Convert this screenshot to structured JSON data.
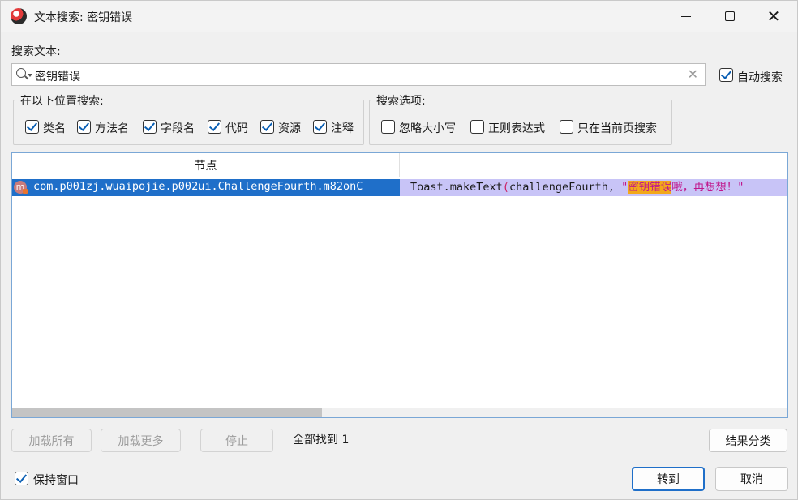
{
  "window": {
    "title": "文本搜索: 密钥错误",
    "minimize_glyph": "",
    "maximize_glyph": "",
    "close_glyph": "✕"
  },
  "search": {
    "label": "搜索文本:",
    "value": "密钥错误",
    "clear_glyph": "✕",
    "auto_search_label": "自动搜索",
    "auto_search_checked": true
  },
  "search_in": {
    "title": "在以下位置搜索:",
    "items": [
      {
        "label": "类名",
        "checked": true
      },
      {
        "label": "方法名",
        "checked": true
      },
      {
        "label": "字段名",
        "checked": true
      },
      {
        "label": "代码",
        "checked": true
      },
      {
        "label": "资源",
        "checked": true
      },
      {
        "label": "注释",
        "checked": true
      }
    ]
  },
  "options": {
    "title": "搜索选项:",
    "items": [
      {
        "label": "忽略大小写",
        "checked": false
      },
      {
        "label": "正则表达式",
        "checked": false
      },
      {
        "label": "只在当前页搜索",
        "checked": false
      }
    ]
  },
  "results": {
    "column_header": "节点",
    "rows": [
      {
        "node_icon": "m",
        "node": "com.p001zj.wuaipojie.p002ui.ChallengeFourth.m82onC",
        "code_prefix": "Toast.makeText",
        "code_paren": "(",
        "code_mid": "challengeFourth, ",
        "code_quote": "\"",
        "code_match": "密钥错误",
        "code_rest": "哦，再想想！\""
      }
    ]
  },
  "buttons": {
    "load_all": "加载所有",
    "load_more": "加载更多",
    "stop": "停止",
    "group_results": "结果分类",
    "go_to": "转到",
    "cancel": "取消"
  },
  "status": {
    "found_text": "全部找到  1"
  },
  "keep_window": {
    "label": "保持窗口",
    "checked": true
  },
  "colors": {
    "selection_blue": "#1f6fc9",
    "code_row_bg": "#c8c4f7",
    "match_highlight": "#f2a81a",
    "string_color": "#c0168c"
  }
}
